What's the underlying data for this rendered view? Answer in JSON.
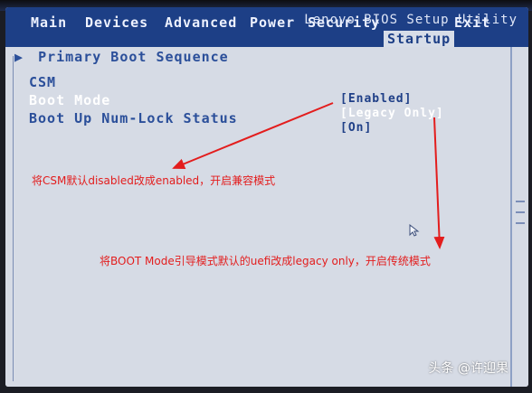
{
  "bios": {
    "title": "Lenovo BIOS Setup Utility",
    "menu": [
      "Main",
      "Devices",
      "Advanced",
      "Power",
      "Security",
      "Startup",
      "Exit"
    ],
    "active_menu": "Startup",
    "section_title": "Primary Boot Sequence",
    "rows": [
      {
        "label": "CSM",
        "value": "[Enabled]",
        "selected": false
      },
      {
        "label": "Boot Mode",
        "value": "[Legacy Only]",
        "selected": true
      },
      {
        "label": "Boot Up Num-Lock Status",
        "value": "[On]",
        "selected": false
      }
    ]
  },
  "annotations": {
    "note_csm": "将CSM默认disabled改成enabled，开启兼容模式",
    "note_boot_mode": "将BOOT Mode引导模式默认的uefi改成legacy only，开启传统模式"
  },
  "watermark": "头条 @许迎果",
  "colors": {
    "bios_blue": "#1d3f86",
    "bios_bg": "#d7dde8",
    "annotation_red": "#e31d1d",
    "selected_text": "#ffffff"
  }
}
